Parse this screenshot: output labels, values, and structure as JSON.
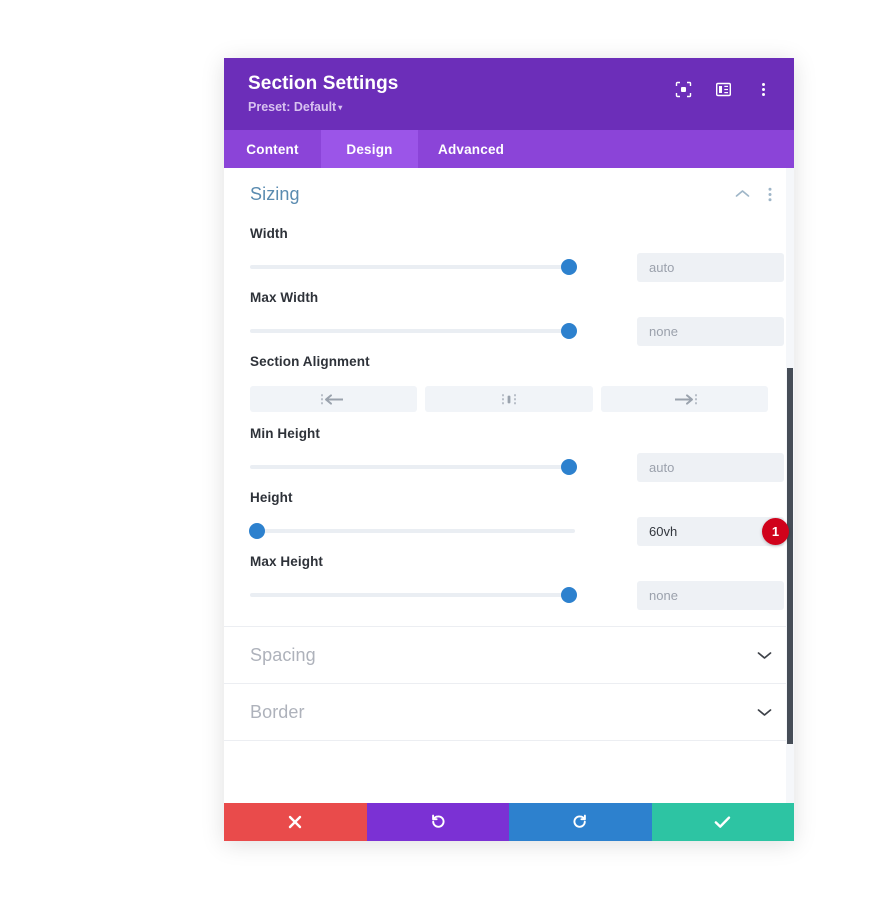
{
  "panel": {
    "title": "Section Settings",
    "preset_label": "Preset: Default",
    "preset_caret": "▾",
    "header_icons": [
      {
        "name": "focus-target-icon"
      },
      {
        "name": "layout-panel-icon"
      },
      {
        "name": "more-vertical-icon"
      }
    ]
  },
  "tabs": [
    {
      "label": "Content",
      "active": false
    },
    {
      "label": "Design",
      "active": true
    },
    {
      "label": "Advanced",
      "active": false
    }
  ],
  "sections": [
    {
      "title": "Sizing",
      "state": "open"
    },
    {
      "title": "Spacing",
      "state": "closed"
    },
    {
      "title": "Border",
      "state": "closed"
    }
  ],
  "sizing": {
    "width": {
      "label": "Width",
      "value": "",
      "placeholder": "auto",
      "slider_percent": 98
    },
    "max_width": {
      "label": "Max Width",
      "value": "",
      "placeholder": "none",
      "slider_percent": 98
    },
    "section_alignment": {
      "label": "Section Alignment",
      "options": [
        {
          "name": "align-left-icon",
          "title": "Left"
        },
        {
          "name": "align-center-icon",
          "title": "Center"
        },
        {
          "name": "align-right-icon",
          "title": "Right"
        }
      ]
    },
    "min_height": {
      "label": "Min Height",
      "value": "",
      "placeholder": "auto",
      "slider_percent": 98
    },
    "height": {
      "label": "Height",
      "value": "60vh",
      "placeholder": "auto",
      "slider_percent": 2,
      "badge": "1"
    },
    "max_height": {
      "label": "Max Height",
      "value": "",
      "placeholder": "none",
      "slider_percent": 98
    }
  },
  "footer": {
    "buttons": [
      {
        "name": "cancel-button",
        "icon": "close-icon",
        "color": "#E94B4B"
      },
      {
        "name": "undo-button",
        "icon": "undo-icon",
        "color": "#7B31D4"
      },
      {
        "name": "redo-button",
        "icon": "redo-icon",
        "color": "#2D81CE"
      },
      {
        "name": "save-button",
        "icon": "check-icon",
        "color": "#2DC4A3"
      }
    ]
  },
  "colors": {
    "header_purple": "#6C2EB9",
    "tabbar_purple": "#8B44D8",
    "tab_active_purple": "#9B55E8",
    "accent_blue": "#2D81CE",
    "badge_red": "#D0021B",
    "section_open_title": "#5A8BB0",
    "section_closed_title": "#aeb2bb"
  }
}
